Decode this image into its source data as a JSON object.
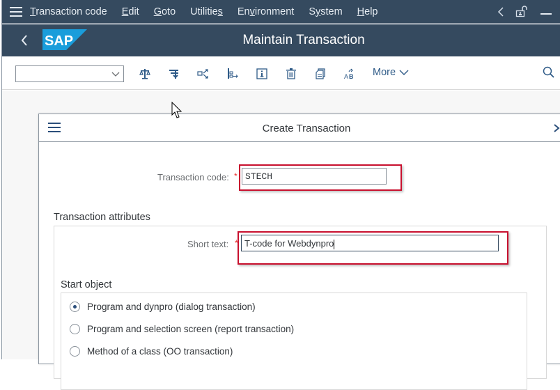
{
  "menubar": {
    "items": [
      {
        "label": "Transaction code",
        "mnemonic": "T"
      },
      {
        "label": "Edit",
        "mnemonic": "E"
      },
      {
        "label": "Goto",
        "mnemonic": "G"
      },
      {
        "label": "Utilities",
        "mnemonic": "s"
      },
      {
        "label": "Environment",
        "mnemonic": "v"
      },
      {
        "label": "System",
        "mnemonic": "y"
      },
      {
        "label": "Help",
        "mnemonic": "H"
      }
    ],
    "icons": [
      "menu-icon",
      "collapse-left-icon",
      "unlock-icon",
      "minimize-icon"
    ]
  },
  "titlebar": {
    "logo_text": "SAP",
    "title": "Maintain Transaction"
  },
  "toolbar": {
    "combo_value": "",
    "icons": [
      "compare-icon",
      "where-used-icon",
      "other-object-icon",
      "hierarchy-icon",
      "info-icon",
      "delete-icon",
      "copy-icon",
      "translate-icon",
      "search-icon"
    ],
    "more_label": "More"
  },
  "dialog": {
    "title": "Create Transaction",
    "transaction_code_label": "Transaction code:",
    "transaction_code_value": "STECH",
    "required_marker": "*",
    "attributes_title": "Transaction attributes",
    "short_text_label": "Short text:",
    "short_text_value": "T-code for Webdynpro",
    "start_object_title": "Start object",
    "start_object_options": [
      {
        "label": "Program and dynpro (dialog transaction)",
        "selected": true
      },
      {
        "label": "Program and selection screen (report transaction)",
        "selected": false
      },
      {
        "label": "Method of a class (OO transaction)",
        "selected": false
      }
    ]
  },
  "colors": {
    "shell_bar": "#354a5f",
    "sap_blue": "#1a9ddb",
    "highlight_red": "#c8102e",
    "accent_text": "#2e5a87"
  }
}
